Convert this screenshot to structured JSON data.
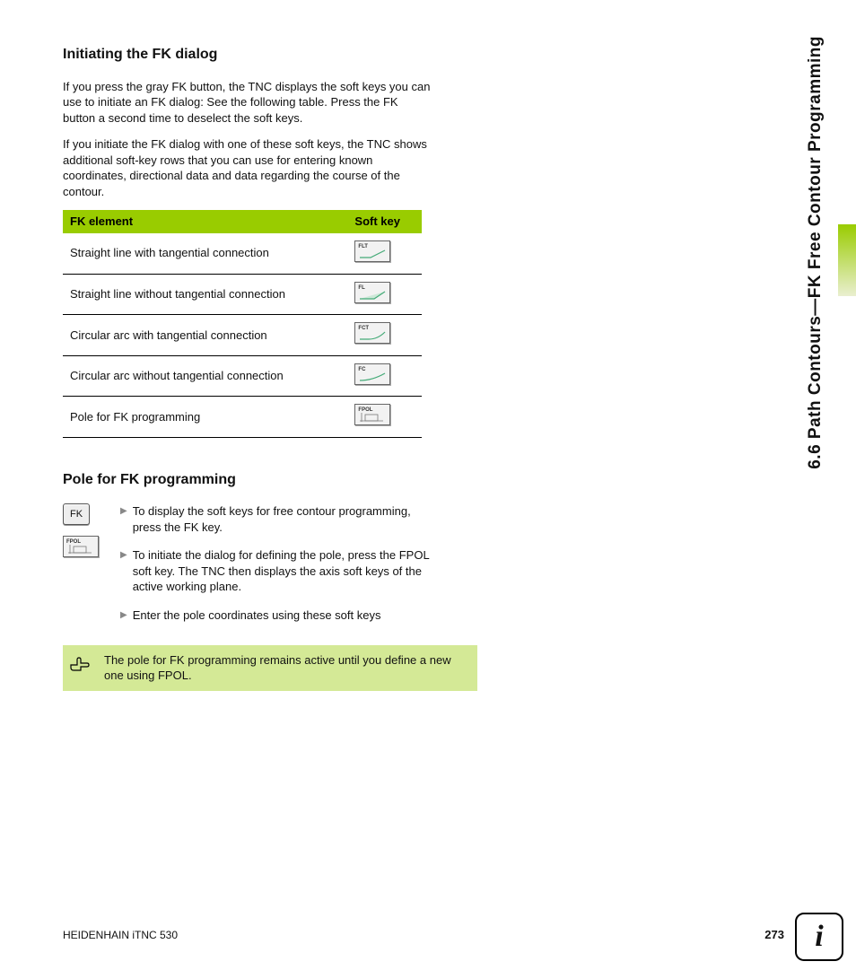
{
  "side_title": "6.6 Path Contours—FK Free Contour Programming",
  "section1": {
    "heading": "Initiating the FK dialog",
    "p1": "If you press the gray FK button, the TNC displays the soft keys you can use to initiate an FK dialog: See the following table. Press the FK button a second time to deselect the soft keys.",
    "p2": "If you initiate the FK dialog with one of these soft keys, the TNC shows additional soft-key rows that you can use for entering known coordinates, directional data and data regarding the course of the contour."
  },
  "table": {
    "headers": {
      "col1": "FK element",
      "col2": "Soft key"
    },
    "rows": [
      {
        "label": "Straight line with tangential connection",
        "key": "FLT"
      },
      {
        "label": "Straight line without tangential connection",
        "key": "FL"
      },
      {
        "label": "Circular arc with tangential connection",
        "key": "FCT"
      },
      {
        "label": "Circular arc without tangential connection",
        "key": "FC"
      },
      {
        "label": "Pole for FK programming",
        "key": "FPOL"
      }
    ]
  },
  "section2": {
    "heading": "Pole for FK programming",
    "fk_key_label": "FK",
    "fpol_key_label": "FPOL",
    "steps": [
      "To display the soft keys for free contour programming, press the FK key.",
      "To initiate the dialog for defining the pole, press the FPOL soft key. The TNC then displays the axis soft keys of the active working plane.",
      "Enter the pole coordinates using these soft keys"
    ],
    "note": "The pole for FK programming remains active until you define a new one using FPOL."
  },
  "footer": {
    "product": "HEIDENHAIN iTNC 530",
    "page": "273"
  },
  "info_glyph": "i"
}
